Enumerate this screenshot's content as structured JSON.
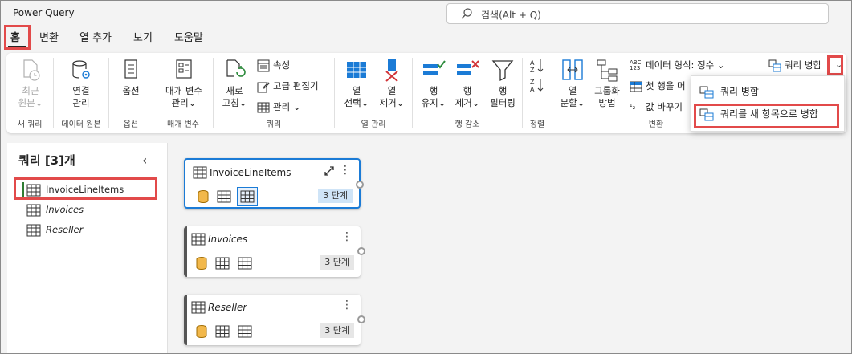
{
  "app": {
    "title": "Power Query"
  },
  "search": {
    "placeholder": "검색(Alt + Q)"
  },
  "tabs": [
    "홈",
    "변환",
    "열 추가",
    "보기",
    "도움말"
  ],
  "ribbon": {
    "new_query": {
      "recent_line1": "최근",
      "recent_line2": "원본",
      "label": "새 쿼리"
    },
    "data_source": {
      "manage_line1": "연결",
      "manage_line2": "관리",
      "label": "데이터 원본"
    },
    "options": {
      "options": "옵션",
      "label": "옵션"
    },
    "parameters": {
      "manage_line1": "매개 변수",
      "manage_line2": "관리",
      "label": "매개 변수"
    },
    "query": {
      "refresh_line1": "새로",
      "refresh_line2": "고침",
      "properties": "속성",
      "advanced_editor": "고급 편집기",
      "manage": "관리",
      "label": "쿼리"
    },
    "columns": {
      "select_line1": "열",
      "select_line2": "선택",
      "remove_line1": "열",
      "remove_line2": "제거",
      "label": "열 관리"
    },
    "rows": {
      "keep_line1": "행",
      "keep_line2": "유지",
      "remove_line1": "행",
      "remove_line2": "제거",
      "filter_line1": "행",
      "filter_line2": "필터링",
      "label": "행 감소"
    },
    "sort": {
      "label": "정렬"
    },
    "transform": {
      "split_line1": "열",
      "split_line2": "분할",
      "group_line1": "그룹화",
      "group_line2": "방법",
      "data_type": "데이터 형식: 정수",
      "first_row": "첫 행을 머",
      "replace_values": "값 바꾸기",
      "label": "변환"
    },
    "combine": {
      "merge_queries": "쿼리 병합"
    }
  },
  "dropdown": {
    "items": [
      "쿼리 병합",
      "쿼리를 새 항목으로 병합"
    ]
  },
  "panel": {
    "title": "쿼리 [3]개",
    "queries": [
      "InvoiceLineItems",
      "Invoices",
      "Reseller"
    ]
  },
  "cards": [
    {
      "title": "InvoiceLineItems",
      "steps": "3 단계"
    },
    {
      "title": "Invoices",
      "steps": "3 단계"
    },
    {
      "title": "Reseller",
      "steps": "3 단계"
    }
  ],
  "colors": {
    "highlight": "#e24a4a",
    "accent": "#1b7bd6",
    "selected_bar": "#2e7d32"
  }
}
